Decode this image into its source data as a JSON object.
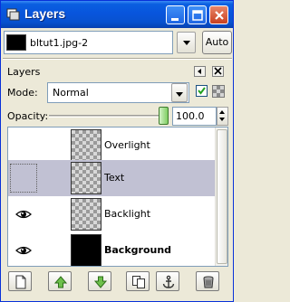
{
  "window": {
    "title": "Layers"
  },
  "image_selector": {
    "value": "bltut1.jpg-2",
    "auto_label": "Auto"
  },
  "dock": {
    "title": "Layers"
  },
  "mode": {
    "label": "Mode:",
    "value": "Normal",
    "lock_alpha_checked": true
  },
  "opacity": {
    "label": "Opacity:",
    "value": "100.0",
    "level": 1.0
  },
  "layers": [
    {
      "name": "Overlight",
      "visible": false,
      "selected": false,
      "bold": false,
      "thumb": "transparent"
    },
    {
      "name": "Text",
      "visible": false,
      "selected": true,
      "bold": false,
      "thumb": "transparent"
    },
    {
      "name": "Backlight",
      "visible": true,
      "selected": false,
      "bold": false,
      "thumb": "transparent"
    },
    {
      "name": "Background",
      "visible": true,
      "selected": false,
      "bold": true,
      "thumb": "black"
    }
  ],
  "toolbar_icons": [
    "new-layer-icon",
    "raise-layer-icon",
    "lower-layer-icon",
    "duplicate-layer-icon",
    "anchor-layer-icon",
    "delete-layer-icon"
  ],
  "colors": {
    "titlebar": "#0855dd",
    "selection": "#c1c1d3",
    "window_bg": "#ece9d8"
  }
}
